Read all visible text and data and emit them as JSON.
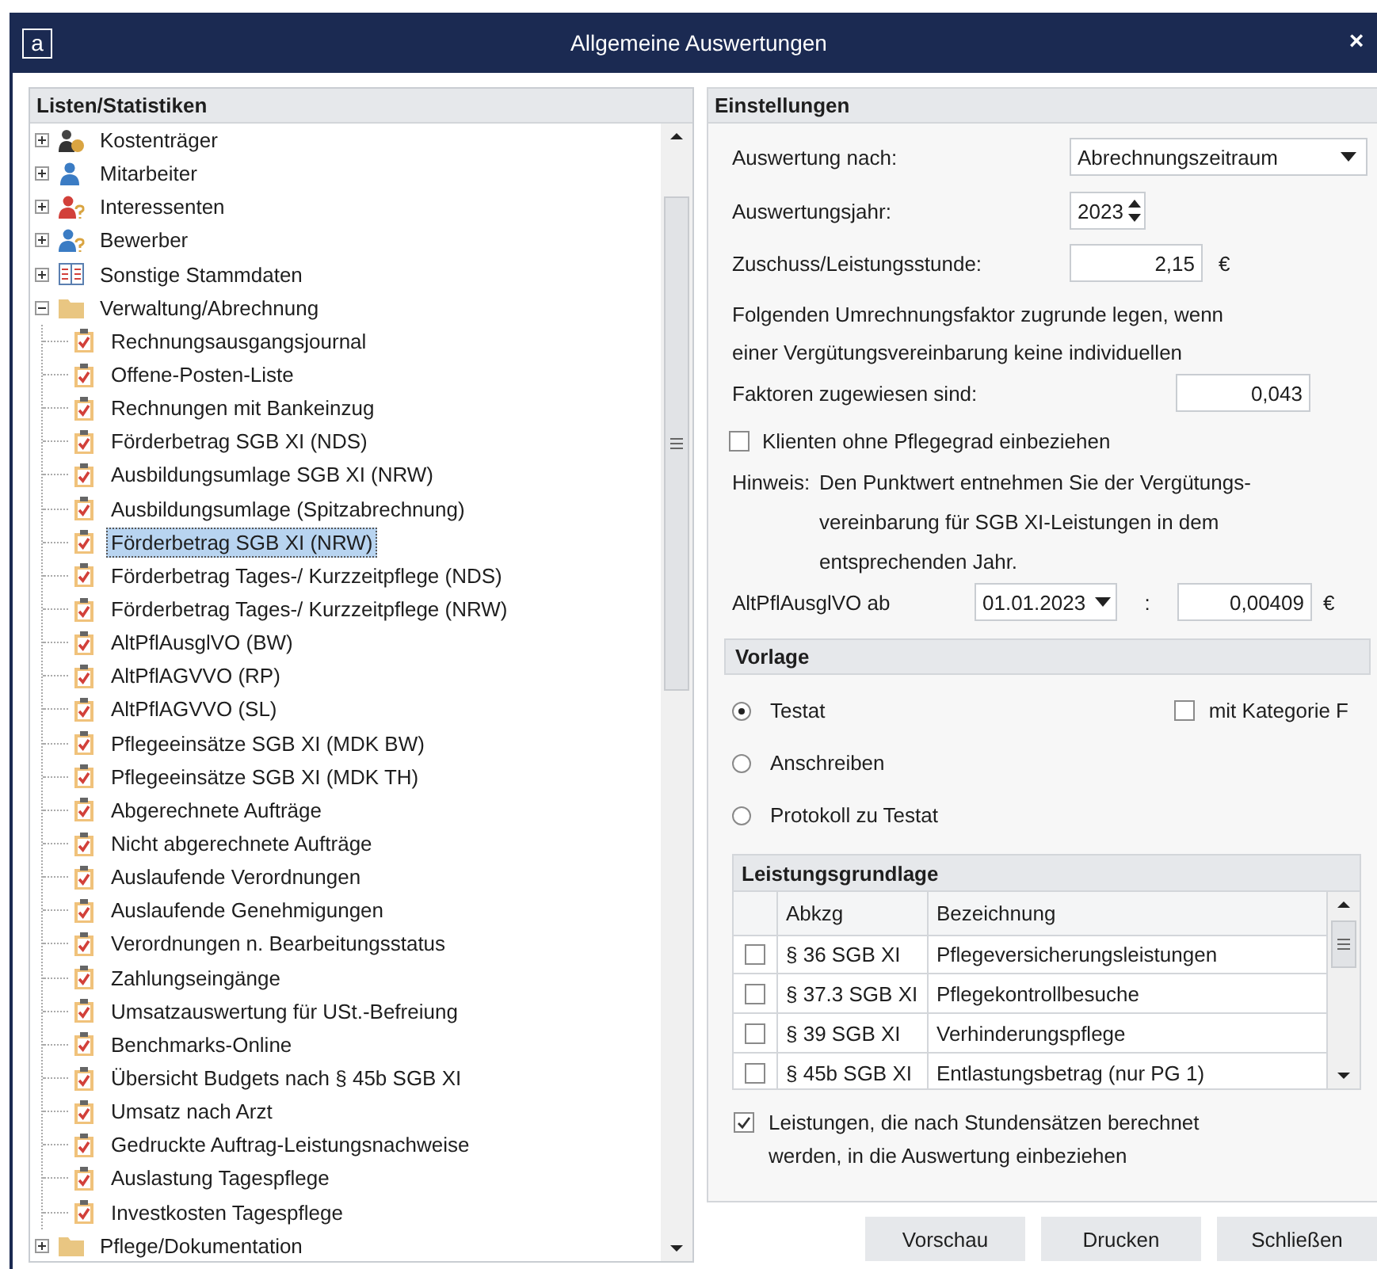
{
  "window": {
    "app_icon": "a",
    "title": "Allgemeine Auswertungen",
    "close": "×"
  },
  "tree": {
    "title": "Listen/Statistiken",
    "nodes": [
      {
        "kind": "payer",
        "label": "Kostenträger",
        "expanded": false,
        "selected": false
      },
      {
        "kind": "staff",
        "label": "Mitarbeiter",
        "expanded": false,
        "selected": false
      },
      {
        "kind": "prospect",
        "label": "Interessenten",
        "expanded": false,
        "selected": false
      },
      {
        "kind": "applicant",
        "label": "Bewerber",
        "expanded": false,
        "selected": false
      },
      {
        "kind": "records",
        "label": "Sonstige Stammdaten",
        "expanded": false,
        "selected": false
      },
      {
        "kind": "folder",
        "label": "Verwaltung/Abrechnung",
        "expanded": true,
        "selected": false,
        "children": [
          {
            "kind": "report",
            "label": "Rechnungsausgangsjournal",
            "selected": false
          },
          {
            "kind": "report",
            "label": "Offene-Posten-Liste",
            "selected": false
          },
          {
            "kind": "report",
            "label": "Rechnungen mit Bankeinzug",
            "selected": false
          },
          {
            "kind": "report",
            "label": "Förderbetrag SGB XI (NDS)",
            "selected": false
          },
          {
            "kind": "report",
            "label": "Ausbildungsumlage SGB XI (NRW)",
            "selected": false
          },
          {
            "kind": "report",
            "label": "Ausbildungsumlage (Spitzabrechnung)",
            "selected": false
          },
          {
            "kind": "report",
            "label": "Förderbetrag SGB XI (NRW)",
            "selected": true
          },
          {
            "kind": "report",
            "label": "Förderbetrag Tages-/ Kurzzeitpflege (NDS)",
            "selected": false
          },
          {
            "kind": "report",
            "label": "Förderbetrag Tages-/ Kurzzeitpflege (NRW)",
            "selected": false
          },
          {
            "kind": "report",
            "label": "AltPflAusglVO (BW)",
            "selected": false
          },
          {
            "kind": "report",
            "label": "AltPflAGVVO (RP)",
            "selected": false
          },
          {
            "kind": "report",
            "label": "AltPflAGVVO (SL)",
            "selected": false
          },
          {
            "kind": "report",
            "label": "Pflegeeinsätze SGB XI (MDK BW)",
            "selected": false
          },
          {
            "kind": "report",
            "label": "Pflegeeinsätze SGB XI (MDK TH)",
            "selected": false
          },
          {
            "kind": "report",
            "label": "Abgerechnete Aufträge",
            "selected": false
          },
          {
            "kind": "report",
            "label": "Nicht abgerechnete Aufträge",
            "selected": false
          },
          {
            "kind": "report",
            "label": "Auslaufende Verordnungen",
            "selected": false
          },
          {
            "kind": "report",
            "label": "Auslaufende Genehmigungen",
            "selected": false
          },
          {
            "kind": "report",
            "label": "Verordnungen n. Bearbeitungsstatus",
            "selected": false
          },
          {
            "kind": "report",
            "label": "Zahlungseingänge",
            "selected": false
          },
          {
            "kind": "report",
            "label": "Umsatzauswertung für USt.-Befreiung",
            "selected": false
          },
          {
            "kind": "report",
            "label": "Benchmarks-Online",
            "selected": false
          },
          {
            "kind": "report",
            "label": "Übersicht Budgets nach § 45b SGB XI",
            "selected": false
          },
          {
            "kind": "report",
            "label": "Umsatz nach Arzt",
            "selected": false
          },
          {
            "kind": "report",
            "label": "Gedruckte Auftrag-Leistungsnachweise",
            "selected": false
          },
          {
            "kind": "report",
            "label": "Auslastung Tagespflege",
            "selected": false
          },
          {
            "kind": "report",
            "label": "Investkosten Tagespflege",
            "selected": false
          }
        ]
      },
      {
        "kind": "folder",
        "label": "Pflege/Dokumentation",
        "expanded": false,
        "selected": false
      }
    ]
  },
  "settings": {
    "title": "Einstellungen",
    "evaluation": {
      "label": "Auswertung nach:",
      "value": "Abrechnungszeitraum"
    },
    "year": {
      "label": "Auswertungsjahr:",
      "value": "2023"
    },
    "subsidy": {
      "label": "Zuschuss/Leistungsstunde:",
      "value": "2,15",
      "unit": "€"
    },
    "factor_text": [
      "Folgenden Umrechnungsfaktor zugrunde legen, wenn",
      "einer Vergütungsvereinbarung keine individuellen"
    ],
    "factor": {
      "label": "Faktoren zugewiesen sind:",
      "value": "0,043"
    },
    "no_grade": {
      "label": "Klienten ohne Pflegegrad einbeziehen",
      "checked": false
    },
    "hint": {
      "label": "Hinweis:",
      "lines": [
        "Den Punktwert entnehmen Sie der Vergütungs-",
        "vereinbarung für SGB XI-Leistungen in dem",
        "entsprechenden Jahr."
      ]
    },
    "altpfl": {
      "label": "AltPflAusglVO ab",
      "date": "01.01.2023",
      "separator": ":",
      "value": "0,00409",
      "unit": "€"
    }
  },
  "template": {
    "title": "Vorlage",
    "options": [
      {
        "label": "Testat",
        "selected": true
      },
      {
        "label": "Anschreiben",
        "selected": false
      },
      {
        "label": "Protokoll zu Testat",
        "selected": false
      }
    ],
    "category": {
      "label": "mit Kategorie F",
      "checked": false
    }
  },
  "basis": {
    "title": "Leistungsgrundlage",
    "columns": [
      "Abkzg",
      "Bezeichnung"
    ],
    "rows": [
      {
        "checked": false,
        "code": "§ 36 SGB XI",
        "name": "Pflegeversicherungsleistungen"
      },
      {
        "checked": false,
        "code": "§ 37.3 SGB XI",
        "name": "Pflegekontrollbesuche"
      },
      {
        "checked": false,
        "code": "§ 39 SGB XI",
        "name": "Verhinderungspflege"
      },
      {
        "checked": false,
        "code": "§ 45b SGB XI",
        "name": "Entlastungsbetrag (nur PG 1)"
      }
    ]
  },
  "hourly": {
    "label": "Leistungen, die nach Stundensätzen berechnet werden, in die Auswertung einbeziehen",
    "checked": true
  },
  "buttons": [
    "Vorschau",
    "Drucken",
    "Schließen"
  ]
}
